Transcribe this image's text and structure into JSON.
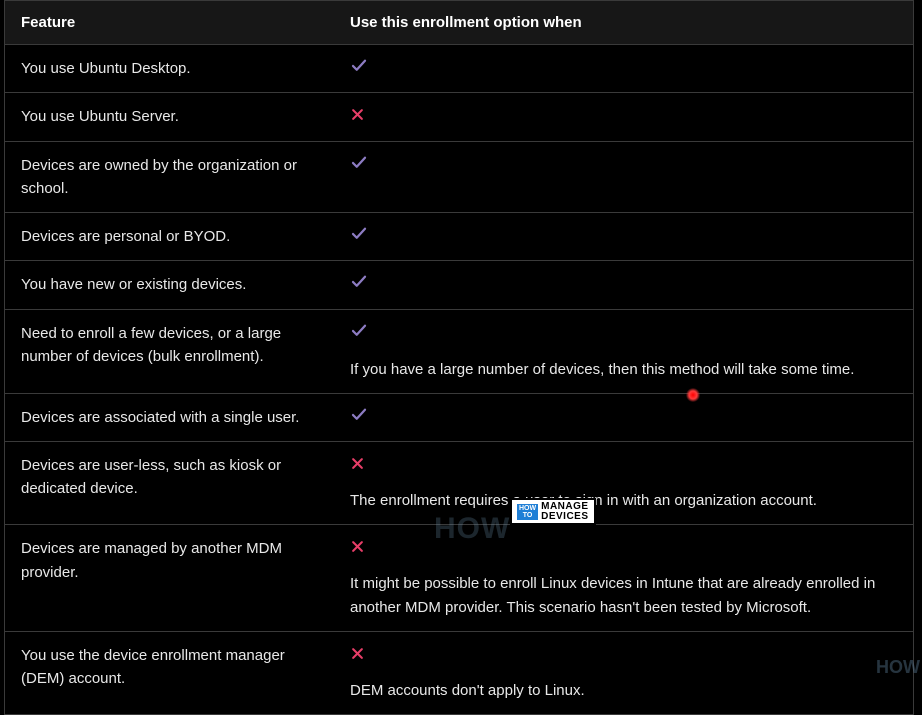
{
  "table": {
    "headers": {
      "feature": "Feature",
      "when": "Use this enrollment option when"
    },
    "rows": [
      {
        "feature": "You use Ubuntu Desktop.",
        "status": "check",
        "detail": ""
      },
      {
        "feature": "You use Ubuntu Server.",
        "status": "cross",
        "detail": ""
      },
      {
        "feature": "Devices are owned by the organization or school.",
        "status": "check",
        "detail": ""
      },
      {
        "feature": "Devices are personal or BYOD.",
        "status": "check",
        "detail": ""
      },
      {
        "feature": "You have new or existing devices.",
        "status": "check",
        "detail": ""
      },
      {
        "feature": "Need to enroll a few devices, or a large number of devices (bulk enrollment).",
        "status": "check",
        "detail": "If you have a large number of devices, then this method will take some time."
      },
      {
        "feature": "Devices are associated with a single user.",
        "status": "check",
        "detail": ""
      },
      {
        "feature": "Devices are user-less, such as kiosk or dedicated device.",
        "status": "cross",
        "detail": "The enrollment requires a user to sign in with an organization account."
      },
      {
        "feature": "Devices are managed by another MDM provider.",
        "status": "cross",
        "detail": "It might be possible to enroll Linux devices in Intune that are already enrolled in another MDM provider. This scenario hasn't been tested by Microsoft."
      },
      {
        "feature": "You use the device enrollment manager (DEM) account.",
        "status": "cross",
        "detail": "DEM accounts don't apply to Linux."
      }
    ]
  },
  "watermark": {
    "ghost": "HOW",
    "box_left_top": "HOW",
    "box_left_bottom": "TO",
    "box_right_top": "MANAGE",
    "box_right_bottom": "DEVICES",
    "corner": "HOW"
  }
}
